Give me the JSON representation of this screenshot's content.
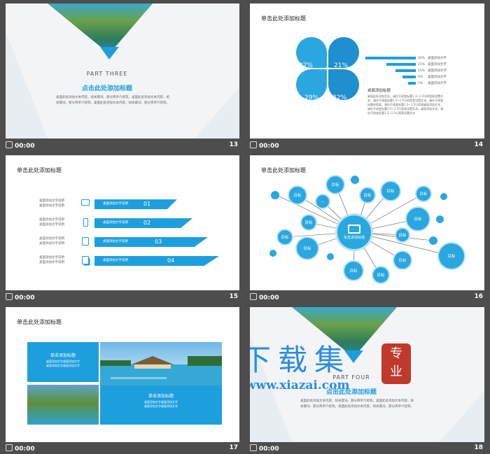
{
  "slides": {
    "s13": {
      "number": "13",
      "time": "00:00",
      "part": "PART THREE",
      "heading": "点击此处添加标题",
      "body1": "桌面此处添加文本内容，如关键词、部分简单介绍等。桌面此处添加文本内容，如",
      "body2": "关键词、部分简单介绍等。桌面此处添加文本内容，如关键词、部分简单介绍等。"
    },
    "s14": {
      "number": "14",
      "time": "00:00",
      "title": "单击此处添加标题",
      "petals": [
        "37%",
        "21%",
        "29%",
        "32%"
      ],
      "bar_labels": [
        "40%",
        "21%",
        "15%",
        "9%",
        "5%"
      ],
      "bar_texts": [
        "桌面添加文字",
        "桌面添加文字",
        "桌面添加文字",
        "桌面添加文字",
        "桌面添加文字"
      ],
      "sub_heading": "桌面添加标题",
      "sub_body": "桌面此处添加文本。请在不改变标题1.3~1.5行的距离设置文本，请在不改变标题1.3~1.5行的距离设置文本。请在不改变标题的距离，请在不改变标题1.3~1.5行距离桌面添加文本，请在不改变标题1.3~1.5行距离设置文本。桌面添加文本，请在不改变标题1.3~1.5行距离设置文本"
    },
    "s15": {
      "number": "15",
      "time": "00:00",
      "title": "单击此处添加标题",
      "rows": [
        {
          "left1": "桌面添加文字说明",
          "left2": "桌面添加文字说明",
          "label": "桌面添加文字说明",
          "num": "01"
        },
        {
          "left1": "桌面添加文字说明",
          "left2": "桌面添加文字说明",
          "label": "桌面添加文字说明",
          "num": "02"
        },
        {
          "left1": "桌面添加文字说明",
          "left2": "桌面添加文字说明",
          "label": "桌面添加文字说明",
          "num": "03"
        },
        {
          "left1": "桌面添加文字说明",
          "left2": "桌面添加文字说明",
          "label": "桌面添加文字说明",
          "num": "04"
        }
      ]
    },
    "s16": {
      "number": "16",
      "time": "00:00",
      "title": "单击此处添加标题",
      "center": "单击添加标题",
      "node_label": "目标",
      "ellipsis": "..."
    },
    "s17": {
      "number": "17",
      "time": "00:00",
      "title": "单击此处添加标题",
      "box1_title": "单击添加标题",
      "box1_l1": "桌面添加文字桌面添加文字",
      "box1_l2": "桌面添加文字桌面添加文字",
      "box2_title": "单击添加标题",
      "box2_l1": "桌面添加文字桌面添加文字",
      "box2_l2": "桌面添加文字桌面添加文字"
    },
    "s18": {
      "number": "18",
      "time": "00:00",
      "part": "PART FOUR",
      "heading": "点击此处添加标题",
      "body1": "桌面此处添加文本内容，如关键词、部分简单介绍等。桌面此处添加文本内容，如",
      "body2": "关键词、部分简单介绍等。桌面此处添加文本内容，如关键词、部分简单介绍等。"
    }
  },
  "watermark": {
    "title": "下载集",
    "seal": "专业",
    "url": "www.xiazai.com"
  },
  "colors": {
    "accent": "#1e9fdd",
    "background": "#4d4d4d"
  }
}
